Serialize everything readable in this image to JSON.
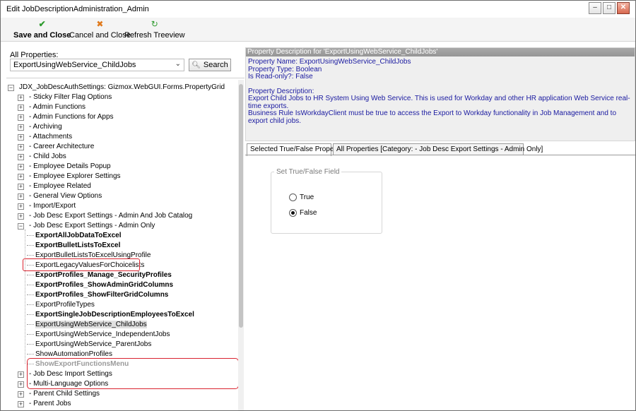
{
  "window": {
    "title": "Edit JobDescriptionAdministration_Admin"
  },
  "toolbar": {
    "save_label": "Save and Close",
    "cancel_label": "Cancel and Close",
    "refresh_label": "Refresh Treeview"
  },
  "left_panel": {
    "all_properties_label": "All Properties:",
    "selected_property": "ExportUsingWebService_ChildJobs",
    "search_label": "Search"
  },
  "tree": {
    "root": "JDX_JobDescAuthSettings: Gizmox.WebGUI.Forms.PropertyGrid",
    "categories_before": [
      "- Sticky Filter Flag Options",
      "- Admin Functions",
      "- Admin Functions for Apps",
      "- Archiving",
      "- Attachments",
      "- Career Architecture",
      "- Child Jobs",
      "- Employee Details Popup",
      "- Employee Explorer Settings",
      "- Employee Related",
      "- General View Options",
      "- Import/Export",
      "- Job Desc Export Settings - Admin And Job Catalog"
    ],
    "expanded_category": "- Job Desc Export Settings - Admin Only",
    "children": [
      "ExportAllJobDataToExcel",
      "ExportBulletListsToExcel",
      "ExportBulletListsToExcelUsingProfile",
      "ExportLegacyValuesForChoicelists",
      "ExportProfiles_Manage_SecurityProfiles",
      "ExportProfiles_ShowAdminGridColumns",
      "ExportProfiles_ShowFilterGridColumns",
      "ExportProfileTypes",
      "ExportSingleJobDescriptionEmployeesToExcel",
      "ExportUsingWebService_ChildJobs",
      "ExportUsingWebService_IndependentJobs",
      "ExportUsingWebService_ParentJobs",
      "ShowAutomationProfiles",
      "ShowExportFunctionsMenu"
    ],
    "categories_after": [
      "- Job Desc Import Settings",
      "- Multi-Language Options",
      "- Parent Child Settings",
      "- Parent Jobs"
    ]
  },
  "description": {
    "header": "Property Description for 'ExportUsingWebService_ChildJobs'",
    "property_name": "Property Name: ExportUsingWebService_ChildJobs",
    "property_type": "Property Type: Boolean",
    "read_only": "Is Read-only?: False",
    "desc_label": "Property Description:",
    "desc_line1": "Export Child Jobs to HR System Using Web Service. This is used for Workday and other HR application Web Service real-time exports.",
    "desc_line2": "Business Rule IsWorkdayClient must be true to access the Export to Workday functionality in Job Management and to export child jobs."
  },
  "tabs": [
    {
      "label": "Selected True/False Property"
    },
    {
      "label": "All Properties [Category: - Job Desc Export Settings - Admin Only]"
    }
  ],
  "editor": {
    "group_label": "Set True/False Field",
    "true_label": "True",
    "false_label": "False",
    "selected_value": "False"
  }
}
